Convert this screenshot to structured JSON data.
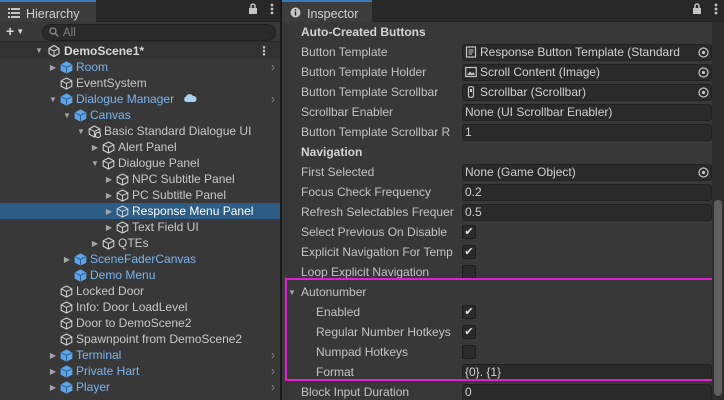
{
  "hierarchy": {
    "tab_label": "Hierarchy",
    "search_placeholder": "All",
    "add_label": "+",
    "scene_name": "DemoScene1*",
    "rows": [
      {
        "label": "Room",
        "depth": 1,
        "arrow": "right",
        "color": "blue",
        "chevron": true
      },
      {
        "label": "EventSystem",
        "depth": 1,
        "arrow": "",
        "color": "normal"
      },
      {
        "label": "Dialogue Manager",
        "depth": 1,
        "arrow": "down",
        "color": "blue",
        "chevron": true,
        "cloud": true
      },
      {
        "label": "Canvas",
        "depth": 2,
        "arrow": "down",
        "color": "blue"
      },
      {
        "label": "Basic Standard Dialogue UI",
        "depth": 3,
        "arrow": "down",
        "color": "normal",
        "icon": "gear"
      },
      {
        "label": "Alert Panel",
        "depth": 4,
        "arrow": "right",
        "color": "normal"
      },
      {
        "label": "Dialogue Panel",
        "depth": 4,
        "arrow": "down",
        "color": "normal"
      },
      {
        "label": "NPC Subtitle Panel",
        "depth": 5,
        "arrow": "right",
        "color": "normal"
      },
      {
        "label": "PC Subtitle Panel",
        "depth": 5,
        "arrow": "right",
        "color": "normal"
      },
      {
        "label": "Response Menu Panel",
        "depth": 5,
        "arrow": "right",
        "color": "white",
        "selected": true
      },
      {
        "label": "Text Field UI",
        "depth": 5,
        "arrow": "right",
        "color": "normal"
      },
      {
        "label": "QTEs",
        "depth": 4,
        "arrow": "right",
        "color": "normal"
      },
      {
        "label": "SceneFaderCanvas",
        "depth": 2,
        "arrow": "right",
        "color": "blue"
      },
      {
        "label": "Demo Menu",
        "depth": 2,
        "arrow": "",
        "color": "blue"
      },
      {
        "label": "Locked Door",
        "depth": 1,
        "arrow": "",
        "color": "normal"
      },
      {
        "label": "Info: Door LoadLevel",
        "depth": 1,
        "arrow": "",
        "color": "normal"
      },
      {
        "label": "Door to DemoScene2",
        "depth": 1,
        "arrow": "",
        "color": "normal"
      },
      {
        "label": "Spawnpoint from DemoScene2",
        "depth": 1,
        "arrow": "",
        "color": "normal"
      },
      {
        "label": "Terminal",
        "depth": 1,
        "arrow": "right",
        "color": "blue",
        "chevron": true
      },
      {
        "label": "Private Hart",
        "depth": 1,
        "arrow": "right",
        "color": "blue",
        "chevron": true
      },
      {
        "label": "Player",
        "depth": 1,
        "arrow": "right",
        "color": "blue",
        "chevron": true
      }
    ]
  },
  "inspector": {
    "tab_label": "Inspector",
    "rows": [
      {
        "kind": "header",
        "label": "Auto-Created Buttons"
      },
      {
        "kind": "object",
        "label": "Button Template",
        "value": "Response Button Template (Standard",
        "icon": "script"
      },
      {
        "kind": "object",
        "label": "Button Template Holder",
        "value": "Scroll Content (Image)",
        "icon": "image"
      },
      {
        "kind": "object",
        "label": "Button Template Scrollbar",
        "value": "Scrollbar (Scrollbar)",
        "icon": "scrollbar"
      },
      {
        "kind": "text",
        "label": "Scrollbar Enabler",
        "value": "None (UI Scrollbar Enabler)"
      },
      {
        "kind": "text",
        "label": "Button Template Scrollbar R",
        "value": "1"
      },
      {
        "kind": "header",
        "label": "Navigation"
      },
      {
        "kind": "object",
        "label": "First Selected",
        "value": "None (Game Object)"
      },
      {
        "kind": "text",
        "label": "Focus Check Frequency",
        "value": "0.2"
      },
      {
        "kind": "text",
        "label": "Refresh Selectables Frequer",
        "value": "0.5"
      },
      {
        "kind": "check",
        "label": "Select Previous On Disable",
        "checked": true
      },
      {
        "kind": "check",
        "label": "Explicit Navigation For Temp",
        "checked": true
      },
      {
        "kind": "check",
        "label": "Loop Explicit Navigation",
        "checked": false
      },
      {
        "kind": "foldout",
        "label": "Autonumber"
      },
      {
        "kind": "check",
        "label": "Enabled",
        "checked": true,
        "indent": true
      },
      {
        "kind": "check",
        "label": "Regular Number Hotkeys",
        "checked": true,
        "indent": true
      },
      {
        "kind": "check",
        "label": "Numpad Hotkeys",
        "checked": false,
        "indent": true
      },
      {
        "kind": "text",
        "label": "Format",
        "value": "{0}. {1}",
        "indent": true
      },
      {
        "kind": "text",
        "label": "Block Input Duration",
        "value": "0"
      }
    ]
  },
  "colors": {
    "accent_blue": "#7ab4ef",
    "selection": "#2c5d87",
    "highlight_box": "#e21fd0",
    "tab_accent": "#3a79bb"
  }
}
